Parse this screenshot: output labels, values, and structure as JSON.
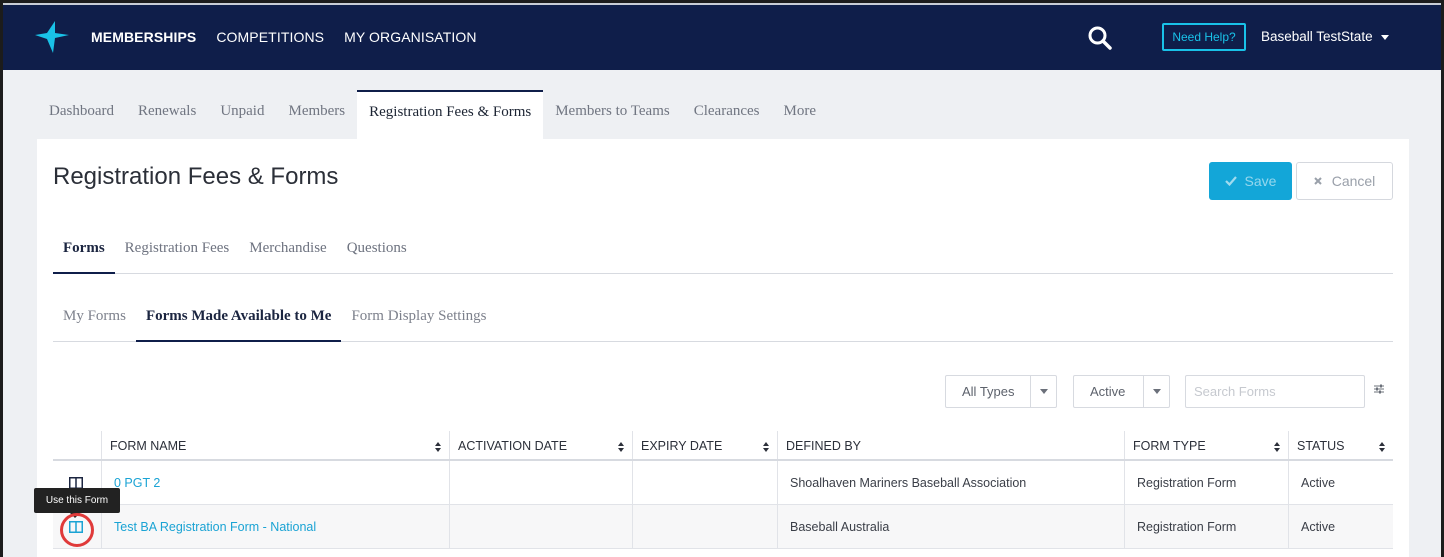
{
  "topnav": {
    "links": [
      "MEMBERSHIPS",
      "COMPETITIONS",
      "MY ORGANISATION"
    ],
    "help_label": "Need Help?",
    "user_name": "Baseball TestState",
    "brand_color": "#0f1e4a",
    "accent_color": "#19c2e8"
  },
  "subnav": {
    "tabs": [
      "Dashboard",
      "Renewals",
      "Unpaid",
      "Members",
      "Registration Fees & Forms",
      "Members to Teams",
      "Clearances",
      "More"
    ]
  },
  "page": {
    "title": "Registration Fees & Forms",
    "save_label": "Save",
    "cancel_label": "Cancel"
  },
  "section_tabs": [
    "Forms",
    "Registration Fees",
    "Merchandise",
    "Questions"
  ],
  "forms_tabs": [
    "My Forms",
    "Forms Made Available to Me",
    "Form Display Settings"
  ],
  "filters": {
    "type_value": "All Types",
    "status_value": "Active",
    "search_placeholder": "Search Forms"
  },
  "table": {
    "headers": [
      "",
      "FORM NAME",
      "ACTIVATION DATE",
      "EXPIRY DATE",
      "DEFINED BY",
      "FORM TYPE",
      "STATUS"
    ],
    "rows": [
      {
        "name": "0 PGT 2",
        "activation": "",
        "expiry": "",
        "defined_by": "Shoalhaven Mariners Baseball Association",
        "type": "Registration Form",
        "status": "Active"
      },
      {
        "name": "Test BA Registration Form - National",
        "activation": "",
        "expiry": "",
        "defined_by": "Baseball Australia",
        "type": "Registration Form",
        "status": "Active"
      }
    ]
  },
  "tooltip": "Use this Form"
}
